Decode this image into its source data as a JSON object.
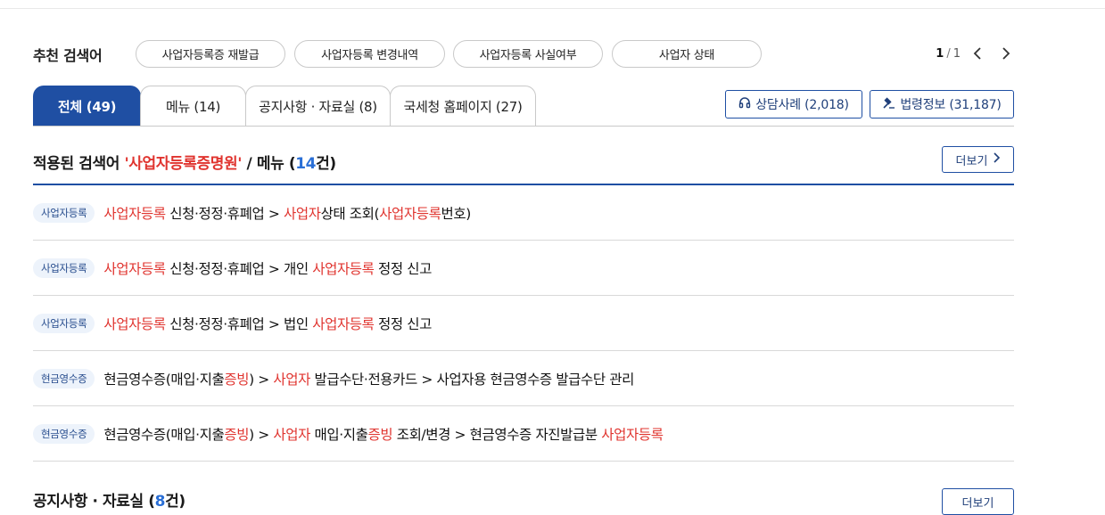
{
  "recommend": {
    "title": "추천 검색어",
    "chips": [
      "사업자등록증 재발급",
      "사업자등록 변경내역",
      "사업자등록 사실여부",
      "사업자 상태"
    ],
    "pager": {
      "current": "1",
      "separator": "/",
      "total": "1"
    }
  },
  "tabs": [
    {
      "label": "전체 (49)",
      "active": true
    },
    {
      "label": "메뉴 (14)",
      "active": false
    },
    {
      "label": "공지사항 · 자료실 (8)",
      "active": false
    },
    {
      "label": "국세청 홈페이지 (27)",
      "active": false
    }
  ],
  "side_buttons": {
    "consult": "상담사례 (2,018)",
    "law": "법령정보 (31,187)"
  },
  "section": {
    "prefix": "적용된 검색어 ",
    "keyword": "'사업자등록증명원'",
    "middle": " / 메뉴 (",
    "count": "14",
    "suffix": "건)",
    "more": "더보기"
  },
  "results": [
    {
      "badge": "사업자등록",
      "segments": [
        {
          "t": "사업자등록",
          "hl": true
        },
        {
          "t": " 신청·정정·휴폐업 > ",
          "hl": false
        },
        {
          "t": "사업자",
          "hl": true
        },
        {
          "t": "상태 조회(",
          "hl": false
        },
        {
          "t": "사업자등록",
          "hl": true
        },
        {
          "t": "번호)",
          "hl": false
        }
      ]
    },
    {
      "badge": "사업자등록",
      "segments": [
        {
          "t": "사업자등록",
          "hl": true
        },
        {
          "t": " 신청·정정·휴폐업 > 개인 ",
          "hl": false
        },
        {
          "t": "사업자등록",
          "hl": true
        },
        {
          "t": " 정정 신고",
          "hl": false
        }
      ]
    },
    {
      "badge": "사업자등록",
      "segments": [
        {
          "t": "사업자등록",
          "hl": true
        },
        {
          "t": " 신청·정정·휴폐업 > 법인 ",
          "hl": false
        },
        {
          "t": "사업자등록",
          "hl": true
        },
        {
          "t": " 정정 신고",
          "hl": false
        }
      ]
    },
    {
      "badge": "현금영수증",
      "segments": [
        {
          "t": "현금영수증(매입·지출",
          "hl": false
        },
        {
          "t": "증빙",
          "hl": true
        },
        {
          "t": ") > ",
          "hl": false
        },
        {
          "t": "사업자",
          "hl": true
        },
        {
          "t": " 발급수단·전용카드 > 사업자용 현금영수증 발급수단 관리",
          "hl": false
        }
      ]
    },
    {
      "badge": "현금영수증",
      "segments": [
        {
          "t": "현금영수증(매입·지출",
          "hl": false
        },
        {
          "t": "증빙",
          "hl": true
        },
        {
          "t": ") > ",
          "hl": false
        },
        {
          "t": "사업자",
          "hl": true
        },
        {
          "t": " 매입·지출",
          "hl": false
        },
        {
          "t": "증빙",
          "hl": true
        },
        {
          "t": " 조회/변경 > 현금영수증 자진발급분 ",
          "hl": false
        },
        {
          "t": "사업자등록",
          "hl": true
        }
      ]
    }
  ],
  "next_section": {
    "title": "공지사항 · 자료실 (",
    "count": "8",
    "suffix": "건)",
    "more": "더보기"
  },
  "colors": {
    "primary": "#1f4fa3",
    "highlight": "#e0342f",
    "count": "#2a6fd6"
  },
  "icons": {
    "prev": "chevron-left-icon",
    "next": "chevron-right-icon",
    "consult": "headset-icon",
    "law": "gavel-icon",
    "more": "chevron-right-icon"
  }
}
